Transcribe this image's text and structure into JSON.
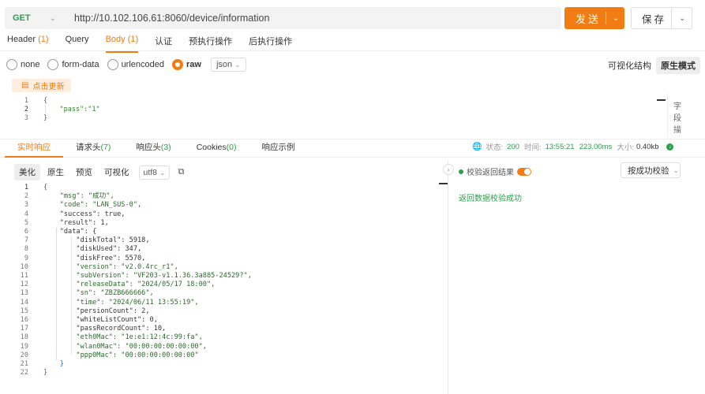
{
  "request": {
    "method": "GET",
    "url": "http://10.102.106.61:8060/device/information",
    "send_label": "发送",
    "save_label": "保存"
  },
  "req_tabs": [
    {
      "label": "Header",
      "count": "(1)"
    },
    {
      "label": "Query",
      "count": ""
    },
    {
      "label": "Body",
      "count": "(1)"
    },
    {
      "label": "认证",
      "count": ""
    },
    {
      "label": "预执行操作",
      "count": ""
    },
    {
      "label": "后执行操作",
      "count": ""
    }
  ],
  "body_types": [
    "none",
    "form-data",
    "urlencoded",
    "raw"
  ],
  "body_type_selected": "raw",
  "body_format": "json",
  "view_modes": {
    "visual": "可视化结构",
    "raw": "原生模式"
  },
  "update_button": "点击更新",
  "request_body": {
    "lines": [
      "{",
      "    \"pass\":\"1\"",
      "}"
    ],
    "side_label": [
      "字",
      "段",
      "描"
    ]
  },
  "resp_tabs": [
    {
      "label": "实时响应",
      "count": ""
    },
    {
      "label": "请求头",
      "count": "(7)"
    },
    {
      "label": "响应头",
      "count": "(3)"
    },
    {
      "label": "Cookies",
      "count": "(0)"
    },
    {
      "label": "响应示例",
      "count": ""
    }
  ],
  "status": {
    "status_label": "状态:",
    "status_value": "200",
    "time_label": "时间:",
    "time_value": "13:55:21",
    "duration": "223.00ms",
    "size_label": "大小:",
    "size_value": "0.40kb"
  },
  "resp_toolbar": [
    "美化",
    "原生",
    "预览",
    "可视化"
  ],
  "encoding": "utf8",
  "validation": {
    "label": "校验返回结果",
    "select": "按成功校验",
    "result": "返回数据校验成功"
  },
  "response_lines": [
    "{",
    "    \"msg\": \"成功\",",
    "    \"code\": \"LAN_SUS-0\",",
    "    \"success\": true,",
    "    \"result\": 1,",
    "    \"data\": {",
    "        \"diskTotal\": 5918,",
    "        \"diskUsed\": 347,",
    "        \"diskFree\": 5570,",
    "        \"version\": \"v2.0.4rc_r1\",",
    "        \"subVersion\": \"VF203-v1.1.36.3a885-24529?\",",
    "        \"releaseData\": \"2024/05/17 18:00\",",
    "        \"sn\": \"ZBZB666666\",",
    "        \"time\": \"2024/06/11 13:55:19\",",
    "        \"persionCount\": 2,",
    "        \"whiteListCount\": 0,",
    "        \"passRecordCount\": 10,",
    "        \"eth0Mac\": \"1e:e1:12:4c:99:fa\",",
    "        \"wlan0Mac\": \"00:00:00:00:00:00\",",
    "        \"ppp0Mac\": \"00:00:00:00:00:00\"",
    "    }",
    "}"
  ],
  "colors": {
    "accent": "#f07c13",
    "success": "#2aa04a"
  }
}
